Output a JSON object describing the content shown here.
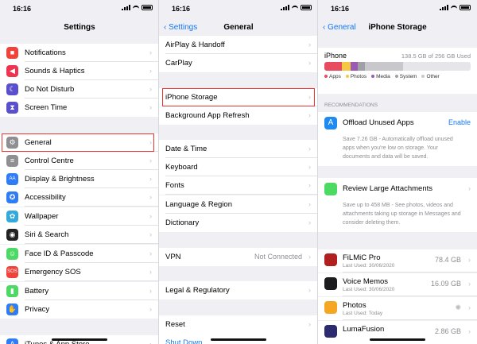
{
  "status": {
    "time": "16:16"
  },
  "panel1": {
    "title": "Settings",
    "items": [
      {
        "label": "Notifications",
        "icon": "notifications-icon",
        "color": "#f0433a",
        "glyph": "■"
      },
      {
        "label": "Sounds & Haptics",
        "icon": "speaker-icon",
        "color": "#f0344f",
        "glyph": "◀"
      },
      {
        "label": "Do Not Disturb",
        "icon": "moon-icon",
        "color": "#5a4fcf",
        "glyph": "☾"
      },
      {
        "label": "Screen Time",
        "icon": "hourglass-icon",
        "color": "#5a4fcf",
        "glyph": "⧗"
      },
      {
        "label": "General",
        "icon": "gear-icon",
        "color": "#8e8e93",
        "glyph": "⚙"
      },
      {
        "label": "Control Centre",
        "icon": "switches-icon",
        "color": "#8e8e93",
        "glyph": "≡"
      },
      {
        "label": "Display & Brightness",
        "icon": "aa-icon",
        "color": "#2f7cf6",
        "glyph": "AA"
      },
      {
        "label": "Accessibility",
        "icon": "accessibility-icon",
        "color": "#2f7cf6",
        "glyph": "✪"
      },
      {
        "label": "Wallpaper",
        "icon": "wallpaper-icon",
        "color": "#34aadc",
        "glyph": "✿"
      },
      {
        "label": "Siri & Search",
        "icon": "siri-icon",
        "color": "#222",
        "glyph": "◉"
      },
      {
        "label": "Face ID & Passcode",
        "icon": "faceid-icon",
        "color": "#4cd964",
        "glyph": "☺"
      },
      {
        "label": "Emergency SOS",
        "icon": "sos-icon",
        "color": "#f0433a",
        "glyph": "SOS"
      },
      {
        "label": "Battery",
        "icon": "battery-icon",
        "color": "#4cd964",
        "glyph": "▮"
      },
      {
        "label": "Privacy",
        "icon": "hand-icon",
        "color": "#2f7cf6",
        "glyph": "✋"
      },
      {
        "label": "iTunes & App Store",
        "icon": "appstore-icon",
        "color": "#2f7cf6",
        "glyph": "A"
      }
    ]
  },
  "panel2": {
    "back": "Settings",
    "title": "General",
    "items": [
      {
        "label": "AirPlay & Handoff"
      },
      {
        "label": "CarPlay"
      },
      {
        "label": "iPhone Storage"
      },
      {
        "label": "Background App Refresh"
      },
      {
        "label": "Date & Time"
      },
      {
        "label": "Keyboard"
      },
      {
        "label": "Fonts"
      },
      {
        "label": "Language & Region"
      },
      {
        "label": "Dictionary"
      },
      {
        "label": "VPN",
        "value": "Not Connected"
      },
      {
        "label": "Legal & Regulatory"
      },
      {
        "label": "Reset"
      }
    ],
    "shutdown": "Shut Down"
  },
  "panel3": {
    "back": "General",
    "title": "iPhone Storage",
    "device": "iPhone",
    "used": "138.5 GB of 256 GB Used",
    "usage_bar": [
      {
        "category": "Apps",
        "fraction": 0.12,
        "color": "#e84a5f"
      },
      {
        "category": "Photos",
        "fraction": 0.06,
        "color": "#f5c842"
      },
      {
        "category": "Media",
        "fraction": 0.05,
        "color": "#9b59b6"
      },
      {
        "category": "System",
        "fraction": 0.05,
        "color": "#a0a0a6"
      },
      {
        "category": "Other",
        "fraction": 0.26,
        "color": "#c8c8cc"
      }
    ],
    "legend": [
      "Apps",
      "Photos",
      "Media",
      "System",
      "Other"
    ],
    "recommendations_header": "RECOMMENDATIONS",
    "rec1": {
      "title": "Offload Unused Apps",
      "action": "Enable",
      "desc": "Save 7.26 GB - Automatically offload unused apps when you're low on storage. Your documents and data will be saved."
    },
    "rec2": {
      "title": "Review Large Attachments",
      "desc": "Save up to 458 MB - See photos, videos and attachments taking up storage in Messages and consider deleting them."
    },
    "apps": [
      {
        "name": "FiLMiC Pro",
        "date": "Last Used: 30/06/2020",
        "size": "78.4 GB",
        "color": "#b0201e"
      },
      {
        "name": "Voice Memos",
        "date": "Last Used: 30/06/2020",
        "size": "16.09 GB",
        "color": "#1c1c1e"
      },
      {
        "name": "Photos",
        "date": "Last Used: Today",
        "size": "",
        "color": "#f5a623"
      },
      {
        "name": "LumaFusion",
        "date": "",
        "size": "2.86 GB",
        "color": "#2b2b6e"
      }
    ]
  }
}
